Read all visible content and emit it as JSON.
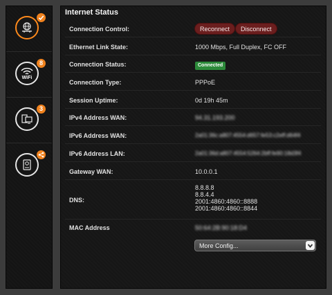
{
  "sidebar": {
    "items": [
      {
        "name": "internet",
        "icon": "globe-router-icon",
        "badge": "check",
        "active": true
      },
      {
        "name": "wifi",
        "icon": "wifi-icon",
        "label": "WiFi",
        "badge": "8"
      },
      {
        "name": "devices",
        "icon": "devices-icon",
        "badge": "3"
      },
      {
        "name": "storage",
        "icon": "hdd-icon",
        "badge": "share"
      }
    ]
  },
  "panel": {
    "title": "Internet Status",
    "rows": [
      {
        "label": "Connection Control:"
      },
      {
        "label": "Ethernet Link State:",
        "value": "1000 Mbps, Full Duplex, FC OFF"
      },
      {
        "label": "Connection Status:",
        "value": "Connected"
      },
      {
        "label": "Connection Type:",
        "value": "PPPoE"
      },
      {
        "label": "Session Uptime:",
        "value": "0d 19h 45m"
      },
      {
        "label": "IPv4 Address WAN:",
        "value": "94.31.193.200"
      },
      {
        "label": "IPv6 Address WAN:",
        "value": "2a01:36c:a807:4554:d657:fe53:c2eff:d64f4"
      },
      {
        "label": "IPv6 Address LAN:",
        "value": "2a01:36d:a807:4554:5264:2bff:fe90:18d3f4"
      },
      {
        "label": "Gateway WAN:",
        "value": "10.0.0.1"
      },
      {
        "label": "DNS:",
        "values": [
          "8.8.8.8",
          "8.8.4.4",
          "2001:4860:4860::8888",
          "2001:4860:4860::8844"
        ]
      },
      {
        "label": "MAC Address",
        "value": "50:64:2B:90:18:D4"
      }
    ],
    "reconnect_label": "Reconnect",
    "disconnect_label": "Disconnect",
    "more_config": "More Config..."
  },
  "colors": {
    "accent": "#f0821e",
    "connected": "#2c8a3a",
    "button": "#6b1e1e"
  }
}
